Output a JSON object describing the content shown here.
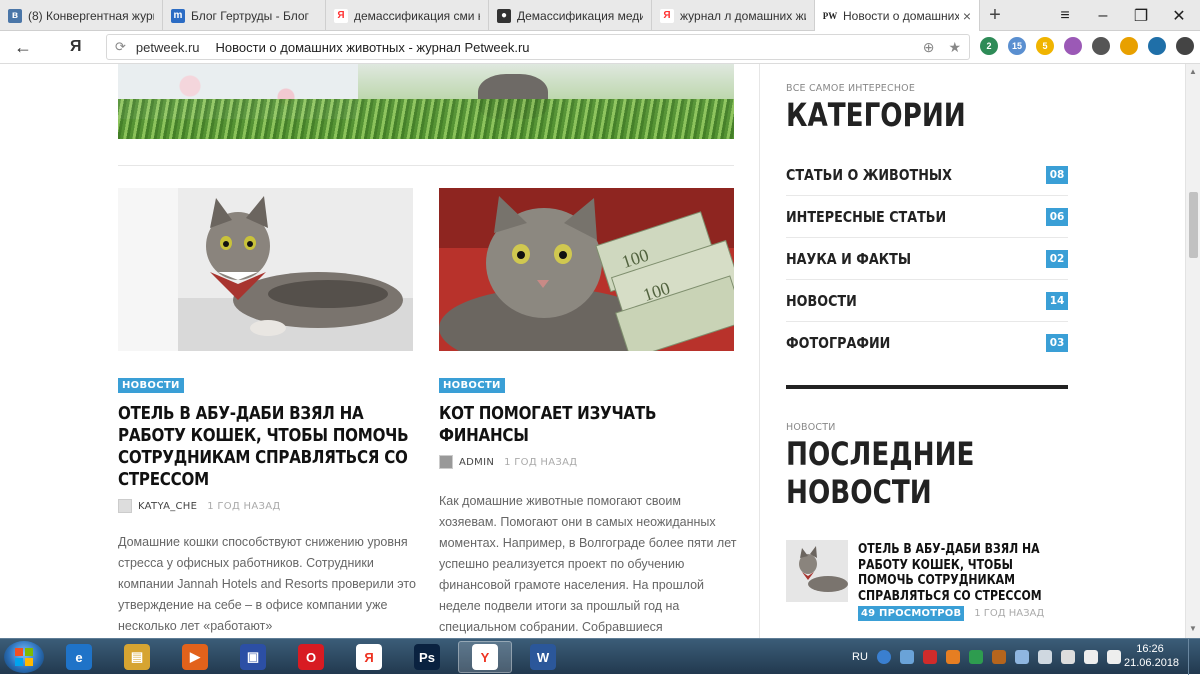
{
  "browser": {
    "tabs": [
      {
        "title": "(8) Конвергентная журна",
        "icon": "vk-favicon",
        "color": "#4a76a8",
        "glyph": "в"
      },
      {
        "title": "Блог Гертруды - Блог",
        "icon": "m-favicon",
        "color": "#2b6cc4",
        "glyph": "m"
      },
      {
        "title": "демассификация сми на",
        "icon": "yandex-favicon",
        "color": "#f33",
        "glyph": "Я"
      },
      {
        "title": "Демассификация медиа",
        "icon": "site-favicon",
        "color": "#333",
        "glyph": "●"
      },
      {
        "title": "журнал л домашних жив",
        "icon": "yandex-favicon",
        "color": "#f33",
        "glyph": "Я"
      },
      {
        "title": "Новости о домашних ж",
        "icon": "pw-favicon",
        "color": "#fff",
        "glyph": "PW",
        "active": true
      }
    ],
    "new_tab": "+",
    "back": "←",
    "yandex_logo": "Я",
    "reload": "⟳",
    "domain": "petweek.ru",
    "page_title": "Новости о домашних животных - журнал Petweek.ru",
    "extensions": [
      {
        "name": "shield-extension-icon",
        "color": "#2e8b57",
        "badge": "2"
      },
      {
        "name": "cloud-extension-icon",
        "color": "#5a8fd0",
        "badge": "15"
      },
      {
        "name": "coin-extension-icon",
        "color": "#f0b400",
        "badge": "5"
      },
      {
        "name": "pen-extension-icon",
        "color": "#9b59b6",
        "badge": ""
      },
      {
        "name": "bulb-extension-icon",
        "color": "#555",
        "badge": ""
      },
      {
        "name": "battery-extension-icon",
        "color": "#e8a000",
        "badge": ""
      },
      {
        "name": "terminal-extension-icon",
        "color": "#1f6fa8",
        "badge": ""
      },
      {
        "name": "download-extension-icon",
        "color": "#444",
        "badge": ""
      }
    ]
  },
  "posts": [
    {
      "badge": "НОВОСТИ",
      "title": "ОТЕЛЬ В АБУ-ДАБИ ВЗЯЛ НА РАБОТУ КОШЕК, ЧТОБЫ ПОМОЧЬ СОТРУДНИКАМ СПРАВЛЯТЬСЯ СО СТРЕССОМ",
      "author": "KATYA_CHE",
      "ago": "1 ГОД НАЗАД",
      "excerpt": "Домашние кошки способствуют снижению уровня стресса у офисных работников. Сотрудники компании Jannah Hotels and Resorts проверили это утверждение на себе – в офисе компании уже несколько лет «работают»"
    },
    {
      "badge": "НОВОСТИ",
      "title": "КОТ ПОМОГАЕТ ИЗУЧАТЬ ФИНАНСЫ",
      "author": "ADMIN",
      "ago": "1 ГОД НАЗАД",
      "excerpt": "Как домашние животные помогают своим хозяевам. Помогают они в самых неожиданных моментах. Например, в Волгограде более пяти лет успешно реализуется проект по обучению финансовой грамоте населения. На прошлой неделе подвели итоги за прошлый год на специальном собрании. Собравшиеся специалисты отметили, что особенно хорошо"
    }
  ],
  "sidebar": {
    "categories_kicker": "ВСЕ САМОЕ ИНТЕРЕСНОЕ",
    "categories_title": "КАТЕГОРИИ",
    "categories": [
      {
        "name": "СТАТЬИ О ЖИВОТНЫХ",
        "count": "08"
      },
      {
        "name": "ИНТЕРЕСНЫЕ СТАТЬИ",
        "count": "06"
      },
      {
        "name": "НАУКА И ФАКТЫ",
        "count": "02"
      },
      {
        "name": "НОВОСТИ",
        "count": "14"
      },
      {
        "name": "ФОТОГРАФИИ",
        "count": "03"
      }
    ],
    "recent_kicker": "НОВОСТИ",
    "recent_title": "ПОСЛЕДНИЕ НОВОСТИ",
    "recent": {
      "title": "ОТЕЛЬ В АБУ-ДАБИ ВЗЯЛ НА РАБОТУ КОШЕК, ЧТОБЫ ПОМОЧЬ СОТРУДНИКАМ СПРАВЛЯТЬСЯ СО СТРЕССОМ",
      "views": "49 ПРОСМОТРОВ",
      "ago": "1 ГОД НАЗАД"
    }
  },
  "taskbar": {
    "apps": [
      {
        "name": "ie-taskbar-icon",
        "color": "#1f73c8",
        "glyph": "e"
      },
      {
        "name": "explorer-taskbar-icon",
        "color": "#d6a431",
        "glyph": "▤"
      },
      {
        "name": "media-taskbar-icon",
        "color": "#e2621b",
        "glyph": "▶"
      },
      {
        "name": "save-taskbar-icon",
        "color": "#2c4fa5",
        "glyph": "▣"
      },
      {
        "name": "opera-taskbar-icon",
        "color": "#d81b22",
        "glyph": "O"
      },
      {
        "name": "yandex-taskbar-icon",
        "color": "#fff",
        "glyph": "Я"
      },
      {
        "name": "photoshop-taskbar-icon",
        "color": "#0a2240",
        "glyph": "Ps"
      },
      {
        "name": "yandex-browser-taskbar-icon",
        "color": "#fff",
        "glyph": "Y",
        "active": true
      },
      {
        "name": "word-taskbar-icon",
        "color": "#2b579a",
        "glyph": "W"
      }
    ],
    "lang": "RU",
    "time": "16:26",
    "date": "21.06.2018"
  }
}
